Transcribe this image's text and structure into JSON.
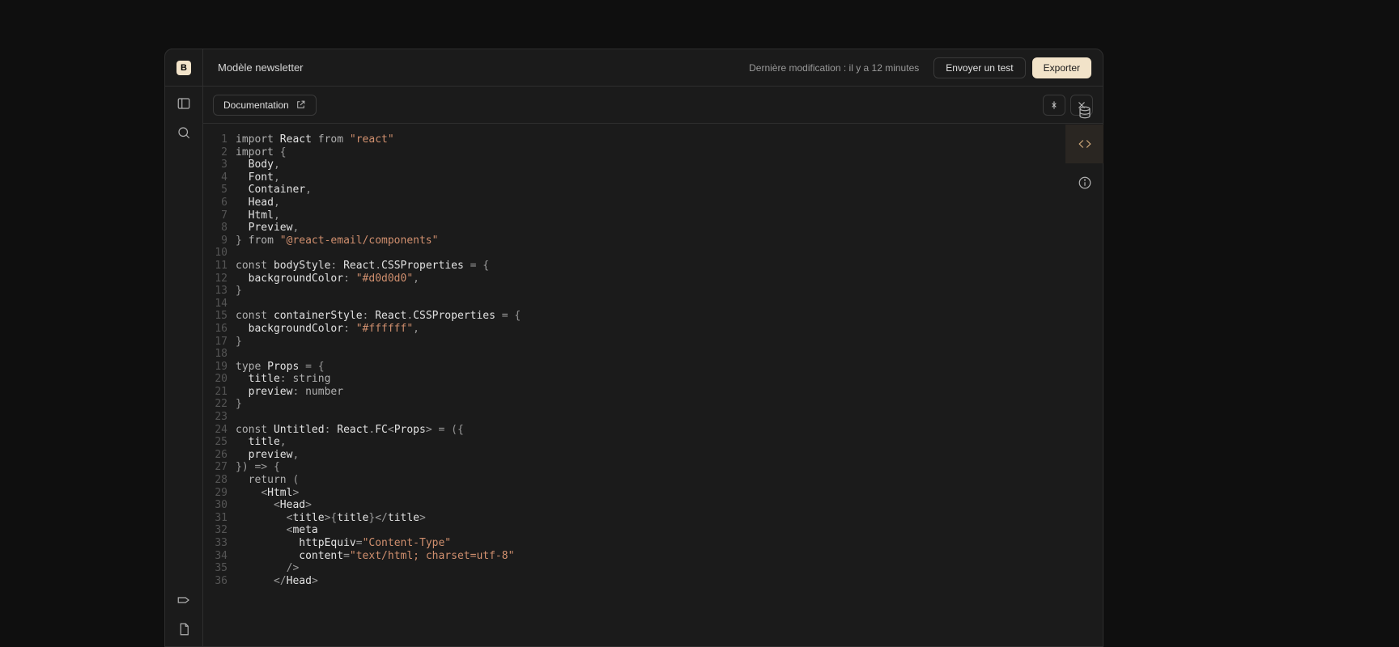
{
  "header": {
    "logo_letter": "B",
    "title": "Modèle newsletter",
    "last_modified_label": "Dernière modification :",
    "last_modified_value": "il y a 12 minutes",
    "send_test_label": "Envoyer un test",
    "export_label": "Exporter"
  },
  "toolbar": {
    "documentation_label": "Documentation"
  },
  "code_lines": [
    [
      [
        "kw",
        "import"
      ],
      [
        "",
        " "
      ],
      [
        "id",
        "React"
      ],
      [
        "",
        " "
      ],
      [
        "kw",
        "from"
      ],
      [
        "",
        " "
      ],
      [
        "str",
        "\"react\""
      ]
    ],
    [
      [
        "kw",
        "import"
      ],
      [
        "",
        " "
      ],
      [
        "pn",
        "{"
      ]
    ],
    [
      [
        "",
        "  "
      ],
      [
        "id",
        "Body"
      ],
      [
        "pn",
        ","
      ]
    ],
    [
      [
        "",
        "  "
      ],
      [
        "id",
        "Font"
      ],
      [
        "pn",
        ","
      ]
    ],
    [
      [
        "",
        "  "
      ],
      [
        "id",
        "Container"
      ],
      [
        "pn",
        ","
      ]
    ],
    [
      [
        "",
        "  "
      ],
      [
        "id",
        "Head"
      ],
      [
        "pn",
        ","
      ]
    ],
    [
      [
        "",
        "  "
      ],
      [
        "id",
        "Html"
      ],
      [
        "pn",
        ","
      ]
    ],
    [
      [
        "",
        "  "
      ],
      [
        "id",
        "Preview"
      ],
      [
        "pn",
        ","
      ]
    ],
    [
      [
        "pn",
        "}"
      ],
      [
        "",
        " "
      ],
      [
        "kw",
        "from"
      ],
      [
        "",
        " "
      ],
      [
        "str",
        "\"@react-email/components\""
      ]
    ],
    [
      [
        "",
        ""
      ]
    ],
    [
      [
        "kw",
        "const"
      ],
      [
        "",
        " "
      ],
      [
        "id",
        "bodyStyle"
      ],
      [
        "pn",
        ":"
      ],
      [
        "",
        " "
      ],
      [
        "id",
        "React"
      ],
      [
        "pn",
        "."
      ],
      [
        "id",
        "CSSProperties"
      ],
      [
        "",
        " "
      ],
      [
        "pn",
        "="
      ],
      [
        "",
        " "
      ],
      [
        "pn",
        "{"
      ]
    ],
    [
      [
        "",
        "  "
      ],
      [
        "id",
        "backgroundColor"
      ],
      [
        "pn",
        ":"
      ],
      [
        "",
        " "
      ],
      [
        "str",
        "\"#d0d0d0\""
      ],
      [
        "pn",
        ","
      ]
    ],
    [
      [
        "pn",
        "}"
      ]
    ],
    [
      [
        "",
        ""
      ]
    ],
    [
      [
        "kw",
        "const"
      ],
      [
        "",
        " "
      ],
      [
        "id",
        "containerStyle"
      ],
      [
        "pn",
        ":"
      ],
      [
        "",
        " "
      ],
      [
        "id",
        "React"
      ],
      [
        "pn",
        "."
      ],
      [
        "id",
        "CSSProperties"
      ],
      [
        "",
        " "
      ],
      [
        "pn",
        "="
      ],
      [
        "",
        " "
      ],
      [
        "pn",
        "{"
      ]
    ],
    [
      [
        "",
        "  "
      ],
      [
        "id",
        "backgroundColor"
      ],
      [
        "pn",
        ":"
      ],
      [
        "",
        " "
      ],
      [
        "str",
        "\"#ffffff\""
      ],
      [
        "pn",
        ","
      ]
    ],
    [
      [
        "pn",
        "}"
      ]
    ],
    [
      [
        "",
        ""
      ]
    ],
    [
      [
        "kw",
        "type"
      ],
      [
        "",
        " "
      ],
      [
        "id",
        "Props"
      ],
      [
        "",
        " "
      ],
      [
        "pn",
        "="
      ],
      [
        "",
        " "
      ],
      [
        "pn",
        "{"
      ]
    ],
    [
      [
        "",
        "  "
      ],
      [
        "id",
        "title"
      ],
      [
        "pn",
        ":"
      ],
      [
        "",
        " "
      ],
      [
        "ty",
        "string"
      ]
    ],
    [
      [
        "",
        "  "
      ],
      [
        "id",
        "preview"
      ],
      [
        "pn",
        ":"
      ],
      [
        "",
        " "
      ],
      [
        "ty",
        "number"
      ]
    ],
    [
      [
        "pn",
        "}"
      ]
    ],
    [
      [
        "",
        ""
      ]
    ],
    [
      [
        "kw",
        "const"
      ],
      [
        "",
        " "
      ],
      [
        "id",
        "Untitled"
      ],
      [
        "pn",
        ":"
      ],
      [
        "",
        " "
      ],
      [
        "id",
        "React"
      ],
      [
        "pn",
        "."
      ],
      [
        "id",
        "FC"
      ],
      [
        "pn",
        "<"
      ],
      [
        "id",
        "Props"
      ],
      [
        "pn",
        ">"
      ],
      [
        "",
        " "
      ],
      [
        "pn",
        "="
      ],
      [
        "",
        " "
      ],
      [
        "pn",
        "({"
      ]
    ],
    [
      [
        "",
        "  "
      ],
      [
        "id",
        "title"
      ],
      [
        "pn",
        ","
      ]
    ],
    [
      [
        "",
        "  "
      ],
      [
        "id",
        "preview"
      ],
      [
        "pn",
        ","
      ]
    ],
    [
      [
        "pn",
        "})"
      ],
      [
        "",
        " "
      ],
      [
        "pn",
        "=>"
      ],
      [
        "",
        " "
      ],
      [
        "pn",
        "{"
      ]
    ],
    [
      [
        "",
        "  "
      ],
      [
        "kw",
        "return"
      ],
      [
        "",
        " "
      ],
      [
        "pn",
        "("
      ]
    ],
    [
      [
        "",
        "    "
      ],
      [
        "pn",
        "<"
      ],
      [
        "id",
        "Html"
      ],
      [
        "pn",
        ">"
      ]
    ],
    [
      [
        "",
        "      "
      ],
      [
        "pn",
        "<"
      ],
      [
        "id",
        "Head"
      ],
      [
        "pn",
        ">"
      ]
    ],
    [
      [
        "",
        "        "
      ],
      [
        "pn",
        "<"
      ],
      [
        "id",
        "title"
      ],
      [
        "pn",
        ">"
      ],
      [
        "pn",
        "{"
      ],
      [
        "id",
        "title"
      ],
      [
        "pn",
        "}"
      ],
      [
        "pn",
        "</"
      ],
      [
        "id",
        "title"
      ],
      [
        "pn",
        ">"
      ]
    ],
    [
      [
        "",
        "        "
      ],
      [
        "pn",
        "<"
      ],
      [
        "id",
        "meta"
      ]
    ],
    [
      [
        "",
        "          "
      ],
      [
        "id",
        "httpEquiv"
      ],
      [
        "pn",
        "="
      ],
      [
        "str",
        "\"Content-Type\""
      ]
    ],
    [
      [
        "",
        "          "
      ],
      [
        "id",
        "content"
      ],
      [
        "pn",
        "="
      ],
      [
        "str",
        "\"text/html; charset=utf-8\""
      ]
    ],
    [
      [
        "",
        "        "
      ],
      [
        "pn",
        "/>"
      ]
    ],
    [
      [
        "",
        "      "
      ],
      [
        "pn",
        "</"
      ],
      [
        "id",
        "Head"
      ],
      [
        "pn",
        ">"
      ]
    ]
  ]
}
